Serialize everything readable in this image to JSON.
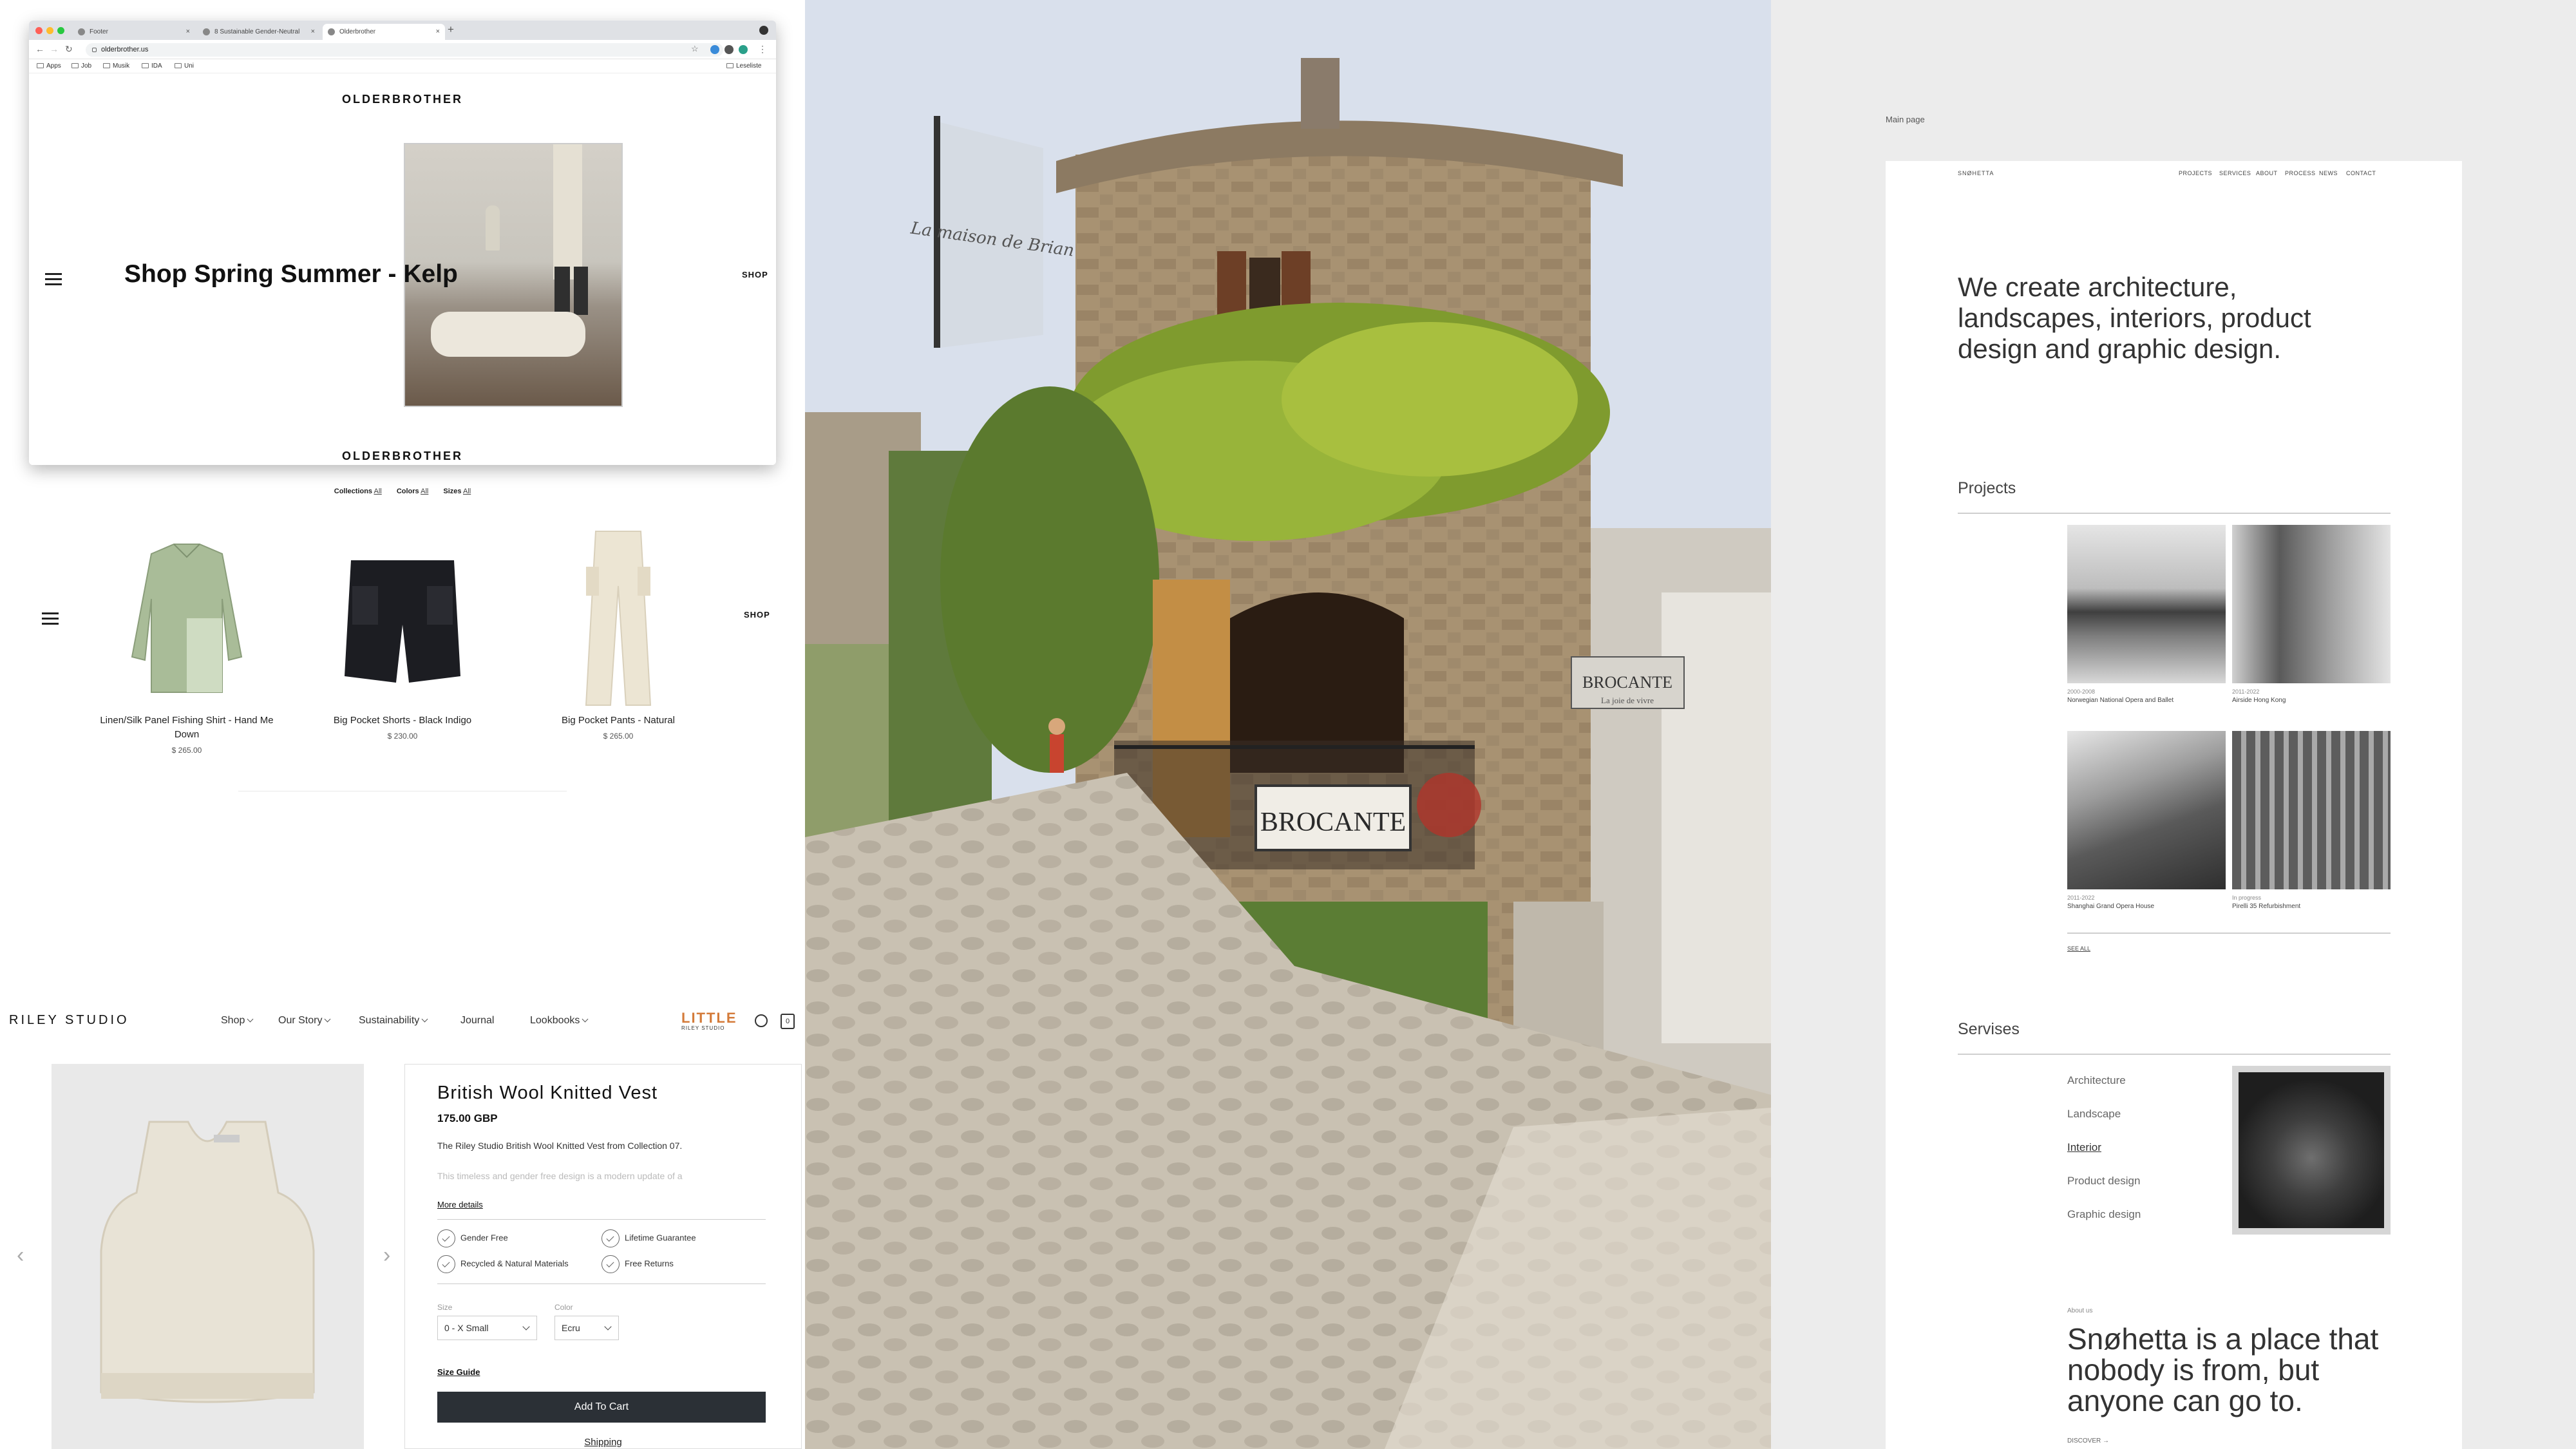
{
  "panel1": {
    "browser": {
      "tabs": [
        {
          "label": "Footer"
        },
        {
          "label": "8 Sustainable Gender-Neutral"
        },
        {
          "label": "Olderbrother"
        }
      ],
      "url": "olderbrother.us",
      "bookmarks": [
        "Apps",
        "Job",
        "Musik",
        "IDA",
        "Uni"
      ],
      "reading_list": "Leseliste"
    },
    "brand": "OLDERBROTHER",
    "hero_text": "Shop Spring Summer - Kelp",
    "shop_label": "SHOP",
    "filters": [
      {
        "label": "Collections",
        "value": "All"
      },
      {
        "label": "Colors",
        "value": "All"
      },
      {
        "label": "Sizes",
        "value": "All"
      }
    ],
    "products": [
      {
        "name": "Linen/Silk Panel Fishing Shirt - Hand Me Down",
        "price": "$ 265.00"
      },
      {
        "name": "Big Pocket Shorts - Black Indigo",
        "price": "$ 230.00"
      },
      {
        "name": "Big Pocket Pants - Natural",
        "price": "$ 265.00"
      }
    ]
  },
  "panel2": {
    "banner_text": "La maison de Brian",
    "sign_text": "BROCANTE",
    "sign_small": "BROCANTE",
    "sign_sub": "La joie de vivre"
  },
  "panel3": {
    "logo": "RILEY STUDIO",
    "nav": [
      "Shop",
      "Our Story",
      "Sustainability",
      "Journal",
      "Lookbooks"
    ],
    "little_logo": "LITTLE",
    "little_sub": "RILEY STUDIO",
    "bag_count": "0",
    "product": {
      "title": "British Wool Knitted Vest",
      "price": "175.00 GBP",
      "description": "The Riley Studio British Wool Knitted Vest from Collection 07.",
      "description_faded": "This timeless and gender free design is a modern update of a",
      "more_details": "More details",
      "features": [
        "Gender Free",
        "Lifetime Guarantee",
        "Recycled & Natural Materials",
        "Free Returns"
      ],
      "size_label": "Size",
      "size_value": "0 - X Small",
      "color_label": "Color",
      "color_value": "Ecru",
      "size_guide": "Size Guide",
      "add_to_cart": "Add To Cart",
      "shipping": "Shipping"
    }
  },
  "panel4": {
    "caption": "Main page",
    "logo": "SNØHETTA",
    "nav": [
      "PROJECTS",
      "SERVICES",
      "ABOUT",
      "PROCESS",
      "NEWS",
      "CONTACT"
    ],
    "hero": "We create architecture, landscapes, interiors, product design and graphic design.",
    "projects_title": "Projects",
    "projects": [
      {
        "years": "2000-2008",
        "name": "Norwegian National Opera and Ballet"
      },
      {
        "years": "2011-2022",
        "name": "Airside Hong Kong"
      },
      {
        "years": "2011-2022",
        "name": "Shanghai Grand Opera House"
      },
      {
        "years": "In progress",
        "name": "Pirelli 35 Refurbishment"
      }
    ],
    "see_all": "SEE ALL",
    "services_title": "Servises",
    "services": [
      "Architecture",
      "Landscape",
      "Interior",
      "Product design",
      "Graphic design"
    ],
    "about_label": "About us",
    "about_quote": "Snøhetta is a place that nobody is from, but anyone can go to.",
    "discover": "DISCOVER →"
  }
}
